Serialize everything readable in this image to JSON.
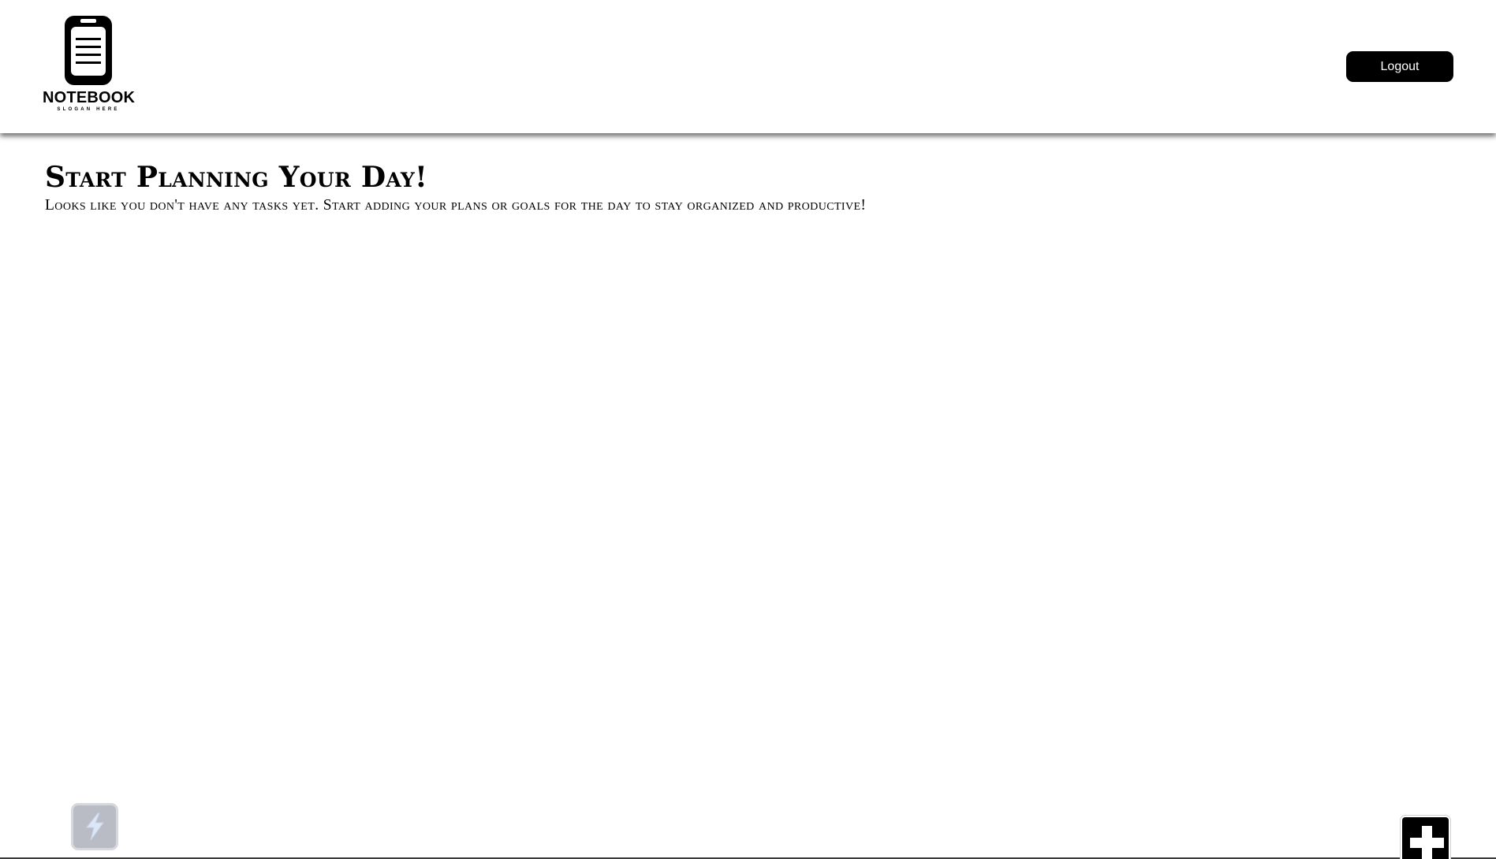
{
  "header": {
    "logo": {
      "title": "NOTEBOOK",
      "slogan": "SLOGAN HERE",
      "icon": "notebook-icon"
    },
    "logout_label": "Logout"
  },
  "main": {
    "title": "Start Planning Your Day!",
    "subtitle": "Looks like you don't have any tasks yet. Start adding your plans or goals for the day to stay organized and productive!"
  },
  "floating_widget": {
    "icon": "lightning-icon"
  },
  "add_button": {
    "icon": "plus-icon"
  },
  "colors": {
    "background": "#ffffff",
    "primary": "#000000",
    "button_text": "#ffffff",
    "widget_bg": "#b9bcc4",
    "widget_icon": "#dbe6f7"
  }
}
